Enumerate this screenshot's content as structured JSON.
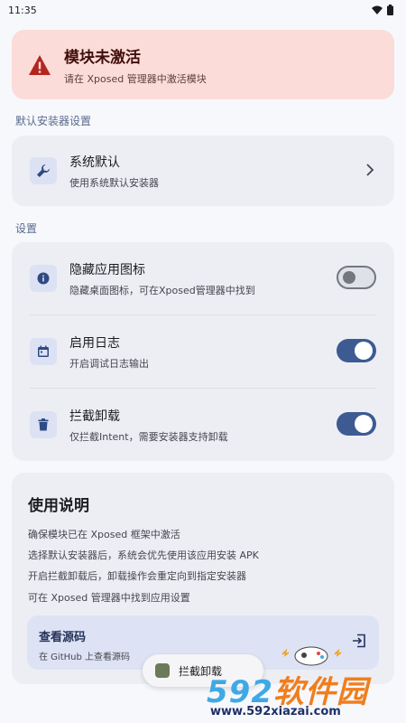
{
  "status": {
    "time": "11:35"
  },
  "alert": {
    "title": "模块未激活",
    "subtitle": "请在 Xposed 管理器中激活模块",
    "icon": "warning-icon",
    "color": "#B3261E"
  },
  "installer_section": {
    "label": "默认安装器设置",
    "item": {
      "title": "系统默认",
      "subtitle": "使用系统默认安装器",
      "icon": "wrench-icon"
    }
  },
  "settings_section": {
    "label": "设置",
    "items": [
      {
        "title": "隐藏应用图标",
        "subtitle": "隐藏桌面图标，可在Xposed管理器中找到",
        "icon": "info-icon",
        "enabled": false
      },
      {
        "title": "启用日志",
        "subtitle": "开启调试日志输出",
        "icon": "calendar-icon",
        "enabled": true
      },
      {
        "title": "拦截卸载",
        "subtitle": "仅拦截Intent，需要安装器支持卸载",
        "icon": "trash-icon",
        "enabled": true
      }
    ]
  },
  "usage": {
    "title": "使用说明",
    "lines": [
      "确保模块已在 Xposed 框架中激活",
      "选择默认安装器后，系统会优先使用该应用安装 APK",
      "开启拦截卸载后，卸载操作会重定向到指定安装器",
      "可在 Xposed 管理器中找到应用设置"
    ],
    "source": {
      "title": "查看源码",
      "subtitle": "在 GitHub 上查看源码",
      "icon": "open-external-icon"
    }
  },
  "toast": {
    "text": "拦截卸载"
  },
  "watermark": {
    "brand_num": "592",
    "brand_cn": "软件园",
    "url": "www.592xiazai.com"
  },
  "colors": {
    "accent": "#3D5A93",
    "background": "#F7F8FC",
    "card": "#EDEEF4"
  }
}
